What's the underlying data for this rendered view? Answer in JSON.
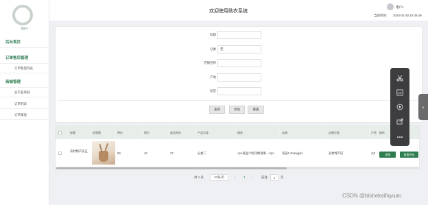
{
  "sidebar": {
    "user": "用户1",
    "items": [
      {
        "label": "后台首页",
        "type": "header"
      },
      {
        "label": "订单售后管理",
        "type": "header"
      },
      {
        "label": "订单售后列表",
        "type": "sub"
      },
      {
        "label": "商城管理",
        "type": "header"
      },
      {
        "label": "农产品商城",
        "type": "sub"
      },
      {
        "label": "订单列表",
        "type": "sub"
      },
      {
        "label": "订单报送",
        "type": "sub"
      }
    ]
  },
  "header": {
    "title": "欢迎使用助农系统",
    "user": "用户1",
    "time_label": "当前时间:",
    "time_value": "2024-01-30 10:46:49"
  },
  "search": {
    "fields": [
      {
        "label": "标题",
        "value": ""
      },
      {
        "label": "分类",
        "value": "无"
      },
      {
        "label": "店铺名称",
        "value": ""
      },
      {
        "label": "产地",
        "value": ""
      },
      {
        "label": "标签",
        "value": ""
      }
    ],
    "buttons": [
      "查询",
      "添加",
      "重置"
    ]
  },
  "table": {
    "columns": [
      "标题",
      "封面图",
      "原价",
      "现价",
      "商品库存",
      "产品分类",
      "描述",
      "店铺",
      "店铺分类",
      "产地",
      "操作"
    ],
    "rows": [
      {
        "title": "农村特产农庄",
        "cover": "",
        "original_price": "59",
        "price": "40",
        "stock": "27",
        "category": "分类二",
        "description": "<p>商品介绍详情说明...</p>",
        "shop": "农园1 shangjia1",
        "shop_category": "农村特产店",
        "origin": "4(3",
        "actions": [
          "详情",
          "查看评论"
        ]
      }
    ]
  },
  "pagination": {
    "total": "共 1 条",
    "page_size": "10条/页",
    "prev": "‹",
    "current": "1",
    "next": "›",
    "goto_label": "前往",
    "goto_value": "1",
    "page_suffix": "页"
  },
  "float_toolbar": {
    "icons": [
      "scissors-icon",
      "gif-icon",
      "play-icon",
      "export-icon",
      "more-icon"
    ]
  },
  "watermark": "CSDN @bishekaifayuan"
}
